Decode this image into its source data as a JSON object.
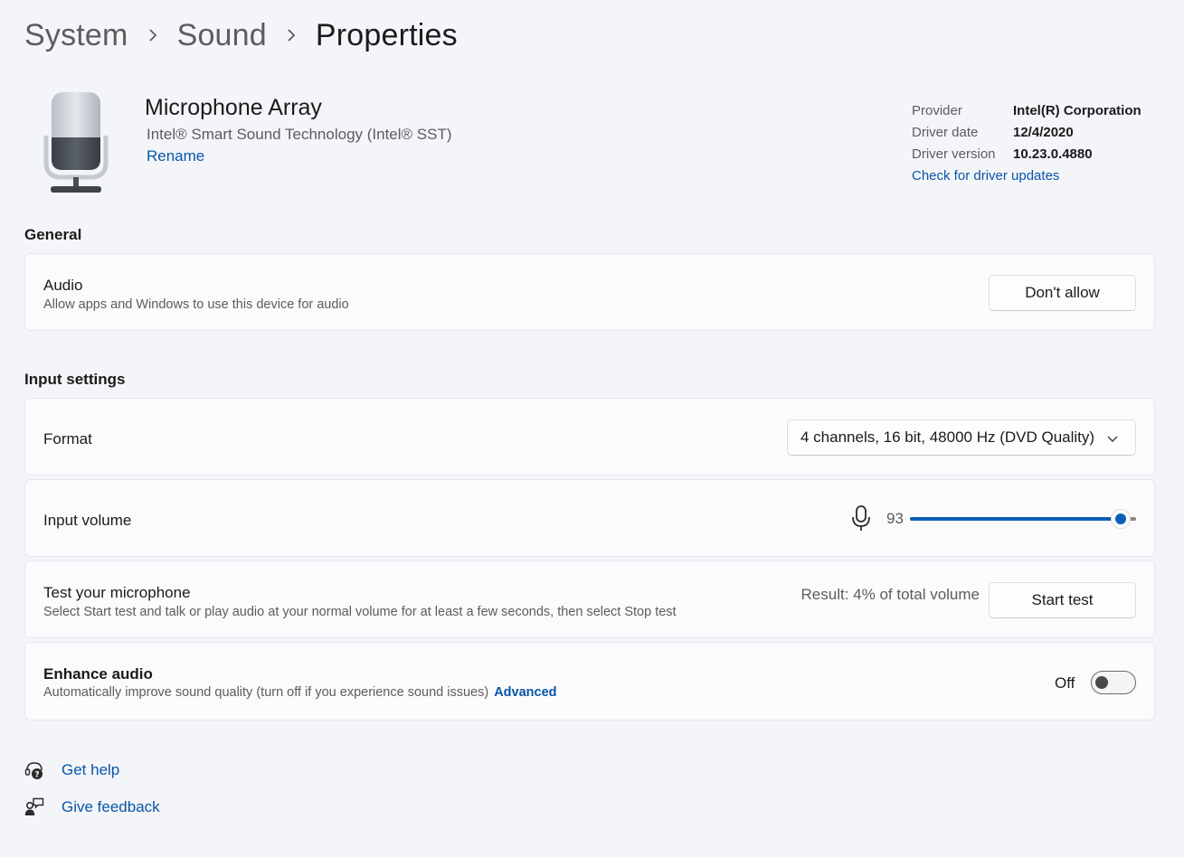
{
  "breadcrumb": [
    {
      "label": "System"
    },
    {
      "label": "Sound"
    },
    {
      "label": "Properties"
    }
  ],
  "device": {
    "icon": "microphone-device-icon",
    "name": "Microphone Array",
    "description": "Intel® Smart Sound Technology (Intel® SST)",
    "rename_label": "Rename"
  },
  "driver": {
    "provider_label": "Provider",
    "provider_value": "Intel(R) Corporation",
    "date_label": "Driver date",
    "date_value": "12/4/2020",
    "version_label": "Driver version",
    "version_value": "10.23.0.4880",
    "update_link": "Check for driver updates"
  },
  "general": {
    "title": "General",
    "audio": {
      "title": "Audio",
      "subtitle": "Allow apps and Windows to use this device for audio",
      "button": "Don't allow"
    }
  },
  "input_settings": {
    "title": "Input settings",
    "format": {
      "title": "Format",
      "selected": "4 channels, 16 bit, 48000 Hz (DVD Quality)"
    },
    "input_volume": {
      "title": "Input volume",
      "value": 93,
      "value_label": "93",
      "icon": "microphone-icon"
    },
    "test": {
      "title": "Test your microphone",
      "subtitle": "Select Start test and talk or play audio at your normal volume for at least a few seconds, then select Stop test",
      "result": "Result: 4% of total volume",
      "button": "Start test"
    },
    "enhance": {
      "title": "Enhance audio",
      "subtitle": "Automatically improve sound quality (turn off if you experience sound issues)",
      "advanced_link": "Advanced",
      "toggle_label": "Off",
      "toggle_on": false
    }
  },
  "footer": {
    "help": {
      "label": "Get help",
      "icon": "help-icon"
    },
    "feedback": {
      "label": "Give feedback",
      "icon": "feedback-icon"
    }
  },
  "colors": {
    "accent": "#0a5fb6",
    "link": "#0a55a8",
    "background": "#f3f5f9",
    "card": "#fbfbfd"
  }
}
